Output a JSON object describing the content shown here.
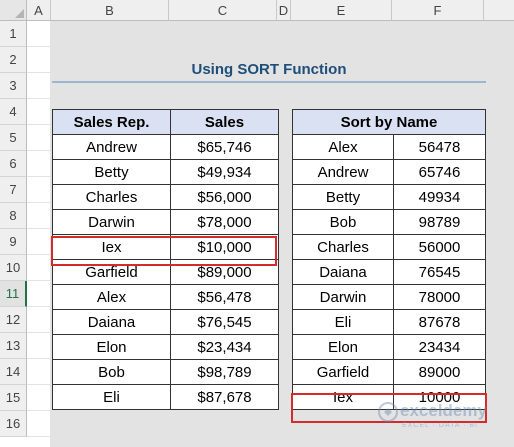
{
  "columns": [
    "A",
    "B",
    "C",
    "D",
    "E",
    "F"
  ],
  "rows": [
    "1",
    "2",
    "3",
    "4",
    "5",
    "6",
    "7",
    "8",
    "9",
    "10",
    "11",
    "12",
    "13",
    "14",
    "15",
    "16"
  ],
  "title": "Using SORT Function",
  "left_table": {
    "headers": [
      "Sales Rep.",
      "Sales"
    ],
    "rows": [
      [
        "Andrew",
        "$65,746"
      ],
      [
        "Betty",
        "$49,934"
      ],
      [
        "Charles",
        "$56,000"
      ],
      [
        "Darwin",
        "$78,000"
      ],
      [
        "Iex",
        "$10,000"
      ],
      [
        "Garfield",
        "$89,000"
      ],
      [
        "Alex",
        "$56,478"
      ],
      [
        "Daiana",
        "$76,545"
      ],
      [
        "Elon",
        "$23,434"
      ],
      [
        "Bob",
        "$98,789"
      ],
      [
        "Eli",
        "$87,678"
      ]
    ]
  },
  "right_table": {
    "header": "Sort by Name",
    "rows": [
      [
        "Alex",
        "56478"
      ],
      [
        "Andrew",
        "65746"
      ],
      [
        "Betty",
        "49934"
      ],
      [
        "Bob",
        "98789"
      ],
      [
        "Charles",
        "56000"
      ],
      [
        "Daiana",
        "76545"
      ],
      [
        "Darwin",
        "78000"
      ],
      [
        "Eli",
        "87678"
      ],
      [
        "Elon",
        "23434"
      ],
      [
        "Garfield",
        "89000"
      ],
      [
        "Iex",
        "10000"
      ]
    ]
  },
  "watermark": {
    "name": "exceldemy",
    "tagline": "EXCEL · DATA · BI"
  },
  "colors": {
    "accent_green": "#217346",
    "highlight_red": "#d62b2b",
    "header_fill": "#d9e1f2",
    "title_blue": "#1f4e79"
  }
}
